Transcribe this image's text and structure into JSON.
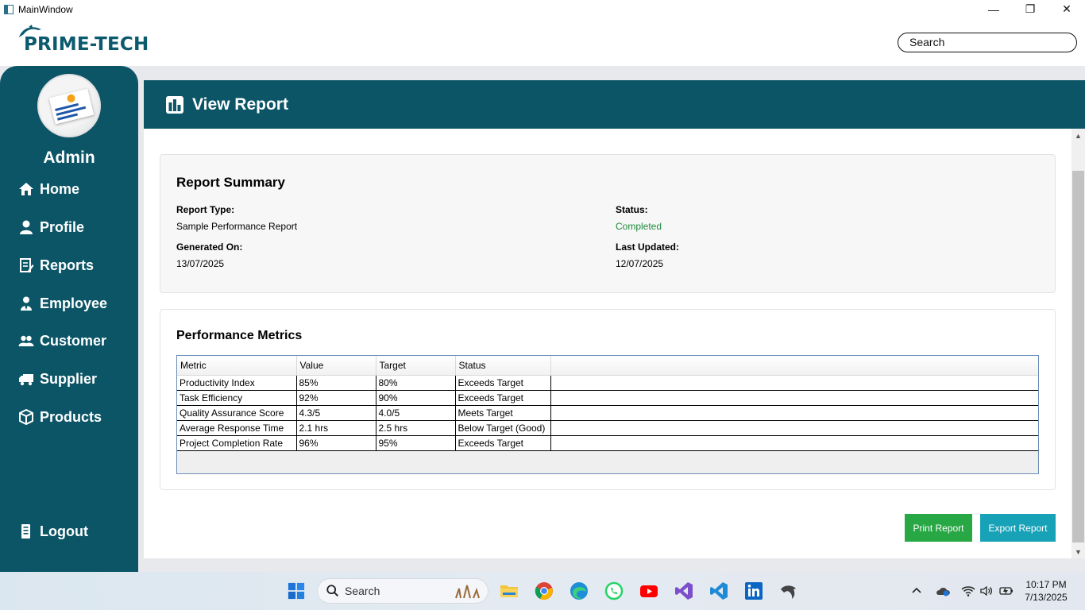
{
  "window": {
    "title": "MainWindow"
  },
  "header": {
    "brand": "PRIME-TECH",
    "search_value": "Search"
  },
  "sidebar": {
    "user": "Admin",
    "items": [
      {
        "label": "Home",
        "icon": "home-icon"
      },
      {
        "label": "Profile",
        "icon": "user-icon"
      },
      {
        "label": "Reports",
        "icon": "report-icon"
      },
      {
        "label": "Employee",
        "icon": "employee-icon"
      },
      {
        "label": "Customer",
        "icon": "customers-icon"
      },
      {
        "label": "Supplier",
        "icon": "truck-icon"
      },
      {
        "label": "Products",
        "icon": "box-icon"
      }
    ],
    "logout": "Logout"
  },
  "page": {
    "title": "View Report"
  },
  "summary": {
    "heading": "Report Summary",
    "report_type_label": "Report Type:",
    "report_type": "Sample Performance Report",
    "generated_label": "Generated On:",
    "generated": "13/07/2025",
    "status_label": "Status:",
    "status": "Completed",
    "updated_label": "Last Updated:",
    "updated": "12/07/2025",
    "status_color": "#1d8a3a"
  },
  "metrics": {
    "heading": "Performance Metrics",
    "columns": [
      "Metric",
      "Value",
      "Target",
      "Status"
    ],
    "rows": [
      [
        "Productivity Index",
        "85%",
        "80%",
        "Exceeds Target"
      ],
      [
        "Task Efficiency",
        "92%",
        "90%",
        "Exceeds Target"
      ],
      [
        "Quality Assurance Score",
        "4.3/5",
        "4.0/5",
        "Meets Target"
      ],
      [
        "Average Response Time",
        "2.1 hrs",
        "2.5 hrs",
        "Below Target (Good)"
      ],
      [
        "Project Completion Rate",
        "96%",
        "95%",
        "Exceeds Target"
      ]
    ]
  },
  "actions": {
    "print": "Print Report",
    "export": "Export Report"
  },
  "colors": {
    "primary": "#0b5566",
    "print": "#28a745",
    "export": "#17a2b8"
  },
  "taskbar": {
    "search_placeholder": "Search",
    "time": "10:17 PM",
    "date": "7/13/2025"
  }
}
